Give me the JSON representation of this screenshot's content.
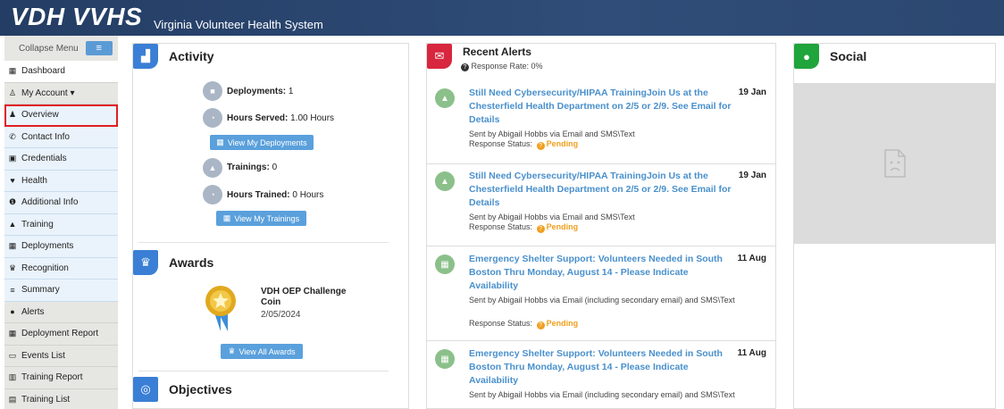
{
  "header": {
    "logo": "VDH VVHS",
    "subtitle": "Virginia Volunteer Health System"
  },
  "sidebar": {
    "collapse_label": "Collapse Menu",
    "collapse_icon": "≡",
    "items": [
      {
        "label": "Dashboard",
        "icon": "▦"
      },
      {
        "label": "My Account ▾",
        "icon": "♙"
      },
      {
        "label": "Overview",
        "icon": "♟"
      },
      {
        "label": "Contact Info",
        "icon": "✆"
      },
      {
        "label": "Credentials",
        "icon": "▣"
      },
      {
        "label": "Health",
        "icon": "♥"
      },
      {
        "label": "Additional Info",
        "icon": "❶"
      },
      {
        "label": "Training",
        "icon": "▲"
      },
      {
        "label": "Deployments",
        "icon": "▦"
      },
      {
        "label": "Recognition",
        "icon": "♛"
      },
      {
        "label": "Summary",
        "icon": "≡"
      },
      {
        "label": "Alerts",
        "icon": "●"
      },
      {
        "label": "Deployment Report",
        "icon": "▦"
      },
      {
        "label": "Events List",
        "icon": "▭"
      },
      {
        "label": "Training Report",
        "icon": "▥"
      },
      {
        "label": "Training List",
        "icon": "▤"
      }
    ]
  },
  "activity": {
    "title": "Activity",
    "deployments_label": "Deployments:",
    "deployments_value": "1",
    "hours_served_label": "Hours Served:",
    "hours_served_value": "1.00 Hours",
    "view_deployments_btn": "View My Deployments",
    "trainings_label": "Trainings:",
    "trainings_value": "0",
    "hours_trained_label": "Hours Trained:",
    "hours_trained_value": "0 Hours",
    "view_trainings_btn": "View My Trainings"
  },
  "awards": {
    "title": "Awards",
    "award_name": "VDH OEP Challenge Coin",
    "award_date": "2/05/2024",
    "view_awards_btn": "View All Awards"
  },
  "objectives": {
    "title": "Objectives"
  },
  "alerts": {
    "title": "Recent Alerts",
    "response_rate": "Response Rate: 0%",
    "items": [
      {
        "title": "Still Need Cybersecurity/HIPAA TrainingJoin Us at the Chesterfield Health Department on 2/5 or 2/9. See Email for Details",
        "date": "19 Jan",
        "sent": "Sent by Abigail Hobbs via Email and SMS\\Text",
        "status_label": "Response Status:",
        "status": "Pending"
      },
      {
        "title": "Still Need Cybersecurity/HIPAA TrainingJoin Us at the Chesterfield Health Department on 2/5 or 2/9. See Email for Details",
        "date": "19 Jan",
        "sent": "Sent by Abigail Hobbs via Email and SMS\\Text",
        "status_label": "Response Status:",
        "status": "Pending"
      },
      {
        "title": "Emergency Shelter Support: Volunteers Needed in South Boston Thru Monday, August 14 - Please Indicate Availability",
        "date": "11 Aug",
        "sent": "Sent by Abigail Hobbs via Email (including secondary email) and SMS\\Text",
        "status_label": "Response Status:",
        "status": "Pending"
      },
      {
        "title": "Emergency Shelter Support: Volunteers Needed in South Boston Thru Monday, August 14 - Please Indicate Availability",
        "date": "11 Aug",
        "sent": "Sent by Abigail Hobbs via Email (including secondary email) and SMS\\Text",
        "status_label": "Response Status:",
        "status": "Pending"
      }
    ]
  },
  "social": {
    "title": "Social"
  }
}
